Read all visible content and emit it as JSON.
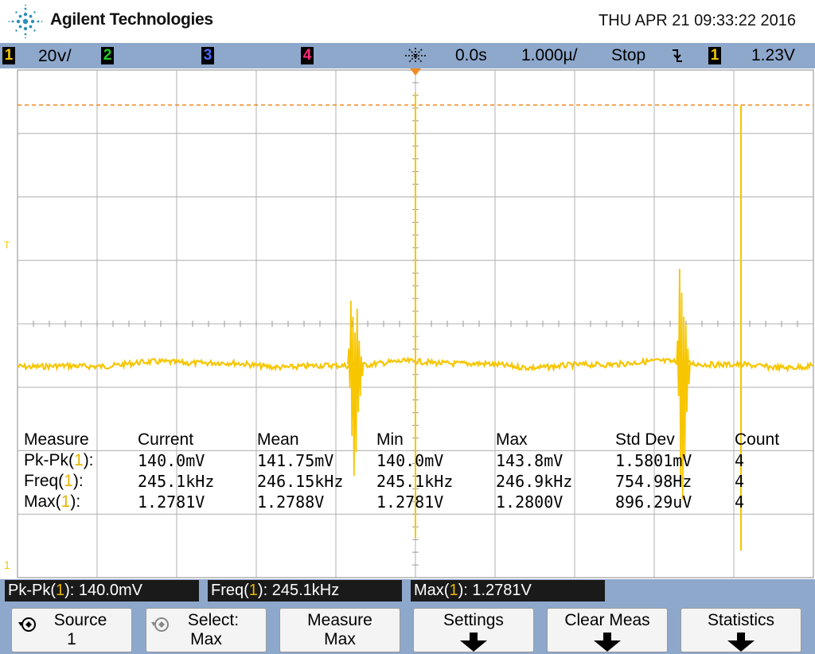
{
  "header": {
    "brand": "Agilent Technologies",
    "datetime": "THU APR 21 09:33:22 2016"
  },
  "settings_bar": {
    "ch1": {
      "label": "1",
      "scale": "20ⅴ/",
      "color": "#f0c800"
    },
    "ch2": {
      "label": "2",
      "color": "#22cc22"
    },
    "ch3": {
      "label": "3",
      "color": "#4a6cff"
    },
    "ch4": {
      "label": "4",
      "color": "#ff2a7a"
    },
    "delay": "0.0s",
    "timebase": "1.000µ/",
    "run_state": "Stop",
    "trigger_slope_icon": "falling-edge",
    "trigger_source": "1",
    "trigger_level": "1.23V"
  },
  "markers": {
    "trigger_level": "T",
    "ground": "1"
  },
  "measurements": {
    "headers": [
      "Measure",
      "Current",
      "Mean",
      "Min",
      "Max",
      "Std Dev",
      "Count"
    ],
    "rows": [
      {
        "name": "Pk-Pk(",
        "ch": "1",
        "suffix": "):",
        "current": "140.0mV",
        "mean": "141.75mV",
        "min": "140.0mV",
        "max": "143.8mV",
        "std": "1.5801mV",
        "count": "4"
      },
      {
        "name": "Freq(",
        "ch": "1",
        "suffix": "):",
        "current": "245.1kHz",
        "mean": "246.15kHz",
        "min": "245.1kHz",
        "max": "246.9kHz",
        "std": "754.98Hz",
        "count": "4"
      },
      {
        "name": "Max(",
        "ch": "1",
        "suffix": "):",
        "current": "1.2781V",
        "mean": "1.2788V",
        "min": "1.2781V",
        "max": "1.2800V",
        "std": "896.29uV",
        "count": "4"
      }
    ]
  },
  "readouts": [
    {
      "name": "Pk-Pk(",
      "ch": "1",
      "value": "): 140.0mV"
    },
    {
      "name": "Freq(",
      "ch": "1",
      "value": "): 245.1kHz"
    },
    {
      "name": "Max(",
      "ch": "1",
      "value": "): 1.2781V"
    }
  ],
  "softkeys": [
    {
      "line1": "Source",
      "line2": "1",
      "icon": "rotate-knob-icon"
    },
    {
      "line1": "Select:",
      "line2": "Max",
      "icon": "rotate-knob-icon"
    },
    {
      "line1": "Measure",
      "line2": "Max"
    },
    {
      "line1": "Settings",
      "line2": ""
    },
    {
      "line1": "Clear Meas",
      "line2": ""
    },
    {
      "line1": "Statistics",
      "line2": ""
    }
  ],
  "colors": {
    "trace": "#f7c600",
    "grid": "#9a9a9a",
    "trigger_line": "#f08a24",
    "bar_blue": "#8ea8cc"
  }
}
